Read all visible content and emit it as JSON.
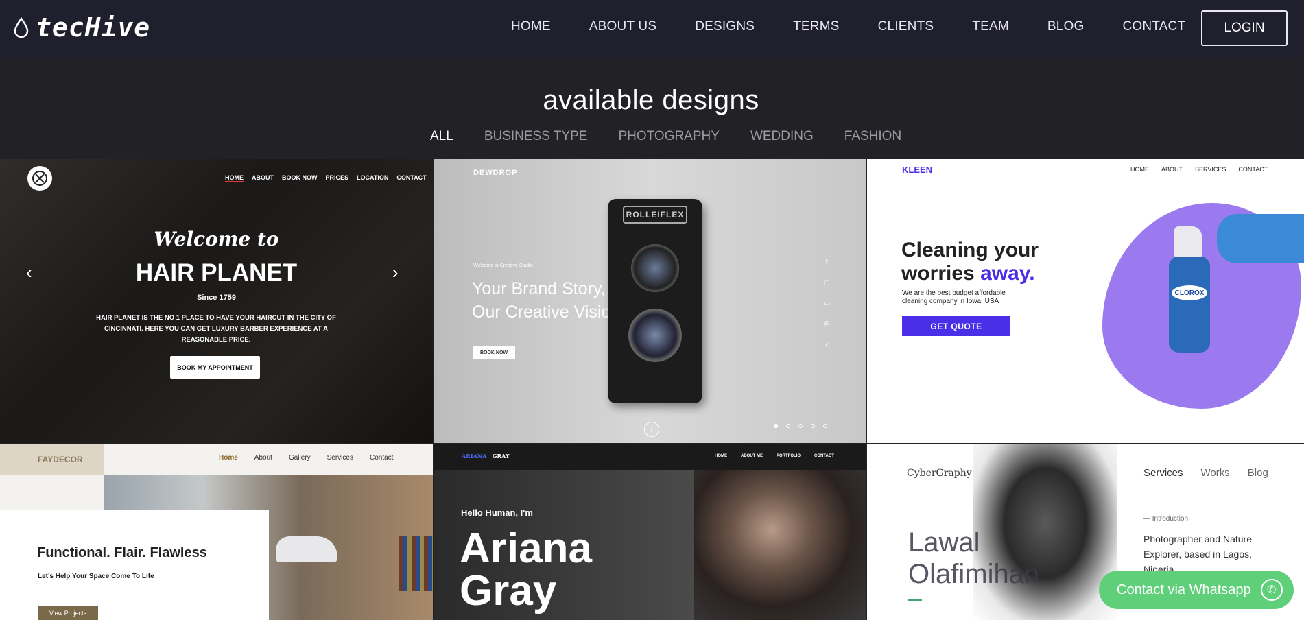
{
  "header": {
    "brand": "tecHive",
    "menu": [
      "HOME",
      "ABOUT US",
      "DESIGNS",
      "TERMS",
      "CLIENTS",
      "TEAM",
      "BLOG",
      "CONTACT"
    ],
    "login": "LOGIN"
  },
  "page": {
    "title": "available designs",
    "filters": [
      "ALL",
      "BUSINESS TYPE",
      "PHOTOGRAPHY",
      "WEDDING",
      "FASHION"
    ],
    "active_filter": "ALL"
  },
  "tiles": {
    "hair": {
      "nav": [
        "HOME",
        "ABOUT",
        "BOOK NOW",
        "PRICES",
        "LOCATION",
        "CONTACT"
      ],
      "welcome": "Welcome to",
      "title": "HAIR PLANET",
      "since": "Since 1759",
      "body": "HAIR PLANET IS THE NO 1 PLACE TO HAVE YOUR HAIRCUT IN THE CITY OF CINCINNATI. HERE YOU CAN GET LUXURY BARBER EXPERIENCE AT A REASONABLE PRICE.",
      "button": "BOOK MY APPOINTMENT"
    },
    "photo": {
      "brand": "DEWDROP",
      "tag": "Welcome to Creative Studio",
      "headline": "Your Brand Story,",
      "headline2": "Our Creative Vision.",
      "button": "BOOK NOW",
      "camera": "ROLLEIFLEX"
    },
    "kleen": {
      "brand": "KLEEN",
      "nav": [
        "HOME",
        "ABOUT",
        "SERVICES",
        "CONTACT"
      ],
      "headline1": "Cleaning your",
      "headline2a": "worries",
      "headline2b": "away.",
      "body": "We are the best budget affordable cleaning company in Iowa, USA",
      "button": "GET QUOTE",
      "bottle": "CLOROX"
    },
    "faydecor": {
      "brand": "FAYDECOR",
      "nav": [
        "Home",
        "About",
        "Gallery",
        "Services",
        "Contact"
      ],
      "headline": "Functional. Flair.  Flawless",
      "sub": "Let’s Help Your Space Come To Life",
      "button": "View Projects"
    },
    "ariana": {
      "brand1": "ARIANA",
      "brand2": "GRAY",
      "nav": [
        "HOME",
        "ABOUT ME",
        "PORTFOLIO",
        "CONTACT"
      ],
      "greet": "Hello Human, I'm",
      "name1": "Ariana",
      "name2": "Gray"
    },
    "cyber": {
      "brand": "CyberGraphy",
      "nav": [
        "Services",
        "Works",
        "Blog"
      ],
      "name1": "Lawal",
      "name2": "Olafimihan",
      "intro": "Introduction",
      "bio": "Photographer and Nature Explorer, based in Lagos, Nigeria"
    }
  },
  "whatsapp": "Contact via Whatsapp",
  "colors": {
    "nav_bg": "#1f1f2e",
    "page_bg": "#222226",
    "kleen_accent": "#4b2fe8",
    "blob": "#9b7af0",
    "whatsapp": "#5fcf7a"
  }
}
